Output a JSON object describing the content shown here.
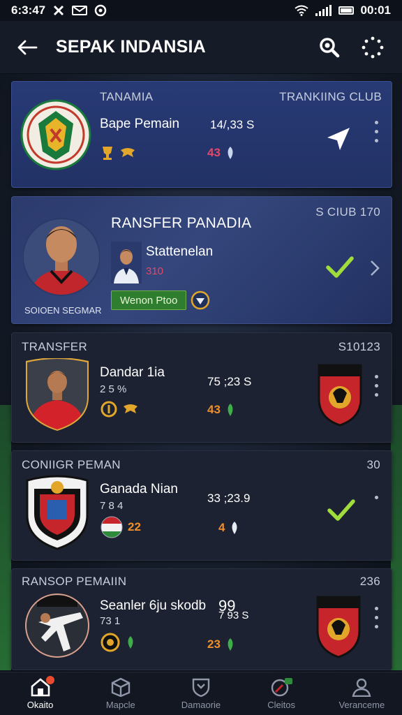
{
  "status_bar": {
    "time": "6:3:47",
    "clock": "00:01"
  },
  "app_bar": {
    "title": "SEPAK INDANSIA"
  },
  "cards": [
    {
      "type": "club",
      "label": "TANAMIA",
      "right_label": "TRANKIING CLUB",
      "name": "Bape Pemain",
      "stat": "14/,33 S",
      "count": "43"
    },
    {
      "type": "transfer",
      "label": "RANSFER PANADIA",
      "right_label": "S CIUB 170",
      "player_caption": "SOIOEN SEGMAR",
      "sub_name": "Stattenelan",
      "sub_value": "310",
      "tag": "Wenon Ptoo"
    },
    {
      "type": "player",
      "label": "TRANSFER",
      "right_label": "S10123",
      "name": "Dandar 1ia",
      "sub": "2 5 %",
      "stat": "75 ;23 S",
      "count": "43"
    },
    {
      "type": "player",
      "label": "CONIIGR PEMAN",
      "right_label": "30",
      "name": "Ganada Nian",
      "sub": "7 8 4",
      "stat": "33 ;23.9",
      "count": "4",
      "flag_count": "22"
    },
    {
      "type": "player",
      "label": "RANSOP PEMAIIN",
      "right_label": "236",
      "name": "Seanler 6ju skodb",
      "sub": "73 1",
      "stat": "99",
      "stat2": "7 93 S",
      "count": "23"
    }
  ],
  "bottom_nav": [
    {
      "label": "Okaito",
      "icon": "home-icon",
      "active": true
    },
    {
      "label": "Mapcle",
      "icon": "box-icon",
      "active": false
    },
    {
      "label": "Damaorie",
      "icon": "shield-icon",
      "active": false
    },
    {
      "label": "Cleitos",
      "icon": "compass-icon",
      "active": false
    },
    {
      "label": "Veranceme",
      "icon": "profile-icon",
      "active": false
    }
  ],
  "colors": {
    "accent_blue": "#283a75",
    "check_green": "#9fdc3c",
    "count_red": "#e2486a",
    "count_orange": "#ef8f2a",
    "badge_orange": "#e64b2f"
  }
}
